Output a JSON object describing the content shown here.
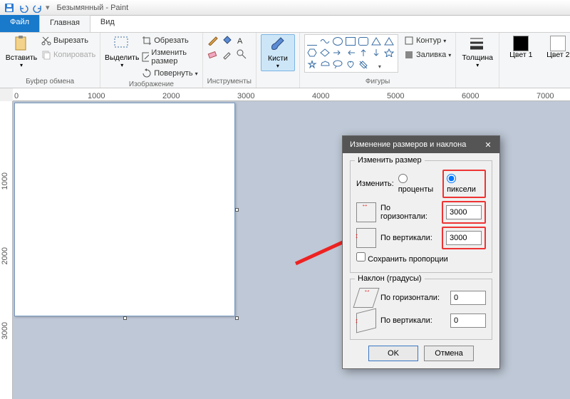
{
  "titlebar": {
    "doc": "Безымянный",
    "app": "Paint"
  },
  "tabs": {
    "file": "Файл",
    "home": "Главная",
    "view": "Вид"
  },
  "ribbon": {
    "clipboard": {
      "paste": "Вставить",
      "cut": "Вырезать",
      "copy": "Копировать",
      "label": "Буфер обмена"
    },
    "image": {
      "select": "Выделить",
      "crop": "Обрезать",
      "resize": "Изменить размер",
      "rotate": "Повернуть",
      "label": "Изображение"
    },
    "tools": {
      "label": "Инструменты"
    },
    "brushes": {
      "btn": "Кисти"
    },
    "shapes": {
      "outline": "Контур",
      "fill": "Заливка",
      "label": "Фигуры"
    },
    "size": {
      "label": "Толщина"
    },
    "colors": {
      "c1": "Цвет 1",
      "c2": "Цвет 2"
    }
  },
  "ruler": {
    "h": [
      "0",
      "1000",
      "2000",
      "3000",
      "4000",
      "5000",
      "6000",
      "7000"
    ],
    "v": [
      "1000",
      "2000",
      "3000"
    ]
  },
  "dialog": {
    "title": "Изменение размеров и наклона",
    "resize_legend": "Изменить размер",
    "change_by": "Изменить:",
    "percent": "проценты",
    "pixels": "пиксели",
    "horiz": "По горизонтали:",
    "vert": "По вертикали:",
    "h_val": "3000",
    "v_val": "3000",
    "keep_ratio": "Сохранить пропорции",
    "skew_legend": "Наклон (градусы)",
    "skew_h": "0",
    "skew_v": "0",
    "ok": "OK",
    "cancel": "Отмена"
  }
}
